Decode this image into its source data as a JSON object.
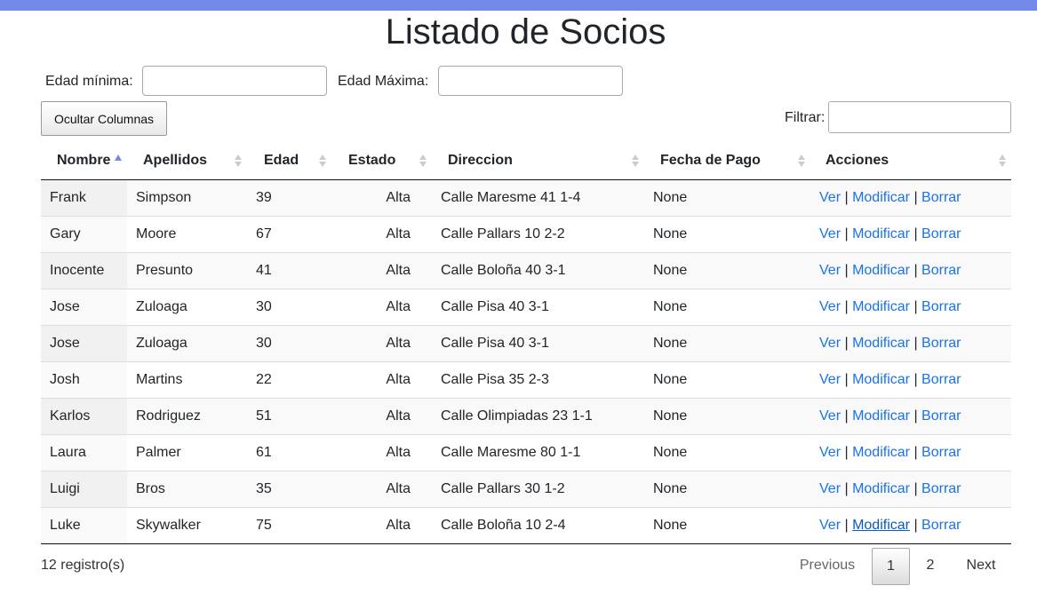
{
  "title": "Listado de Socios",
  "filters": {
    "min_age_label": "Edad mínima:",
    "min_age_value": "",
    "max_age_label": "Edad Máxima:",
    "max_age_value": "",
    "hide_columns_button": "Ocultar Columnas",
    "search_label": "Filtrar:",
    "search_value": ""
  },
  "table": {
    "columns": [
      "Nombre",
      "Apellidos",
      "Edad",
      "Estado",
      "Direccion",
      "Fecha de Pago",
      "Acciones"
    ],
    "sorted_column": "Nombre",
    "sort_direction": "asc",
    "actions": {
      "view": "Ver",
      "edit": "Modificar",
      "delete": "Borrar",
      "separator": "|"
    },
    "rows": [
      {
        "nombre": "Frank",
        "apellidos": "Simpson",
        "edad": "39",
        "estado": "Alta",
        "direccion": "Calle Maresme 41 1-4",
        "fecha_pago": "None"
      },
      {
        "nombre": "Gary",
        "apellidos": "Moore",
        "edad": "67",
        "estado": "Alta",
        "direccion": "Calle Pallars 10 2-2",
        "fecha_pago": "None"
      },
      {
        "nombre": "Inocente",
        "apellidos": "Presunto",
        "edad": "41",
        "estado": "Alta",
        "direccion": "Calle Boloña 40 3-1",
        "fecha_pago": "None"
      },
      {
        "nombre": "Jose",
        "apellidos": "Zuloaga",
        "edad": "30",
        "estado": "Alta",
        "direccion": "Calle Pisa 40 3-1",
        "fecha_pago": "None"
      },
      {
        "nombre": "Jose",
        "apellidos": "Zuloaga",
        "edad": "30",
        "estado": "Alta",
        "direccion": "Calle Pisa 40 3-1",
        "fecha_pago": "None"
      },
      {
        "nombre": "Josh",
        "apellidos": "Martins",
        "edad": "22",
        "estado": "Alta",
        "direccion": "Calle Pisa 35 2-3",
        "fecha_pago": "None"
      },
      {
        "nombre": "Karlos",
        "apellidos": "Rodriguez",
        "edad": "51",
        "estado": "Alta",
        "direccion": "Calle Olimpiadas 23 1-1",
        "fecha_pago": "None"
      },
      {
        "nombre": "Laura",
        "apellidos": "Palmer",
        "edad": "61",
        "estado": "Alta",
        "direccion": "Calle Maresme 80 1-1",
        "fecha_pago": "None"
      },
      {
        "nombre": "Luigi",
        "apellidos": "Bros",
        "edad": "35",
        "estado": "Alta",
        "direccion": "Calle Pallars 30 1-2",
        "fecha_pago": "None"
      },
      {
        "nombre": "Luke",
        "apellidos": "Skywalker",
        "edad": "75",
        "estado": "Alta",
        "direccion": "Calle Boloña 10 2-4",
        "fecha_pago": "None"
      }
    ]
  },
  "footer": {
    "records_info": "12 registro(s)",
    "previous": "Previous",
    "pages": [
      "1",
      "2"
    ],
    "current_page": "1",
    "next": "Next"
  },
  "colors": {
    "accent": "#7289e8",
    "link": "#1a73e8"
  }
}
